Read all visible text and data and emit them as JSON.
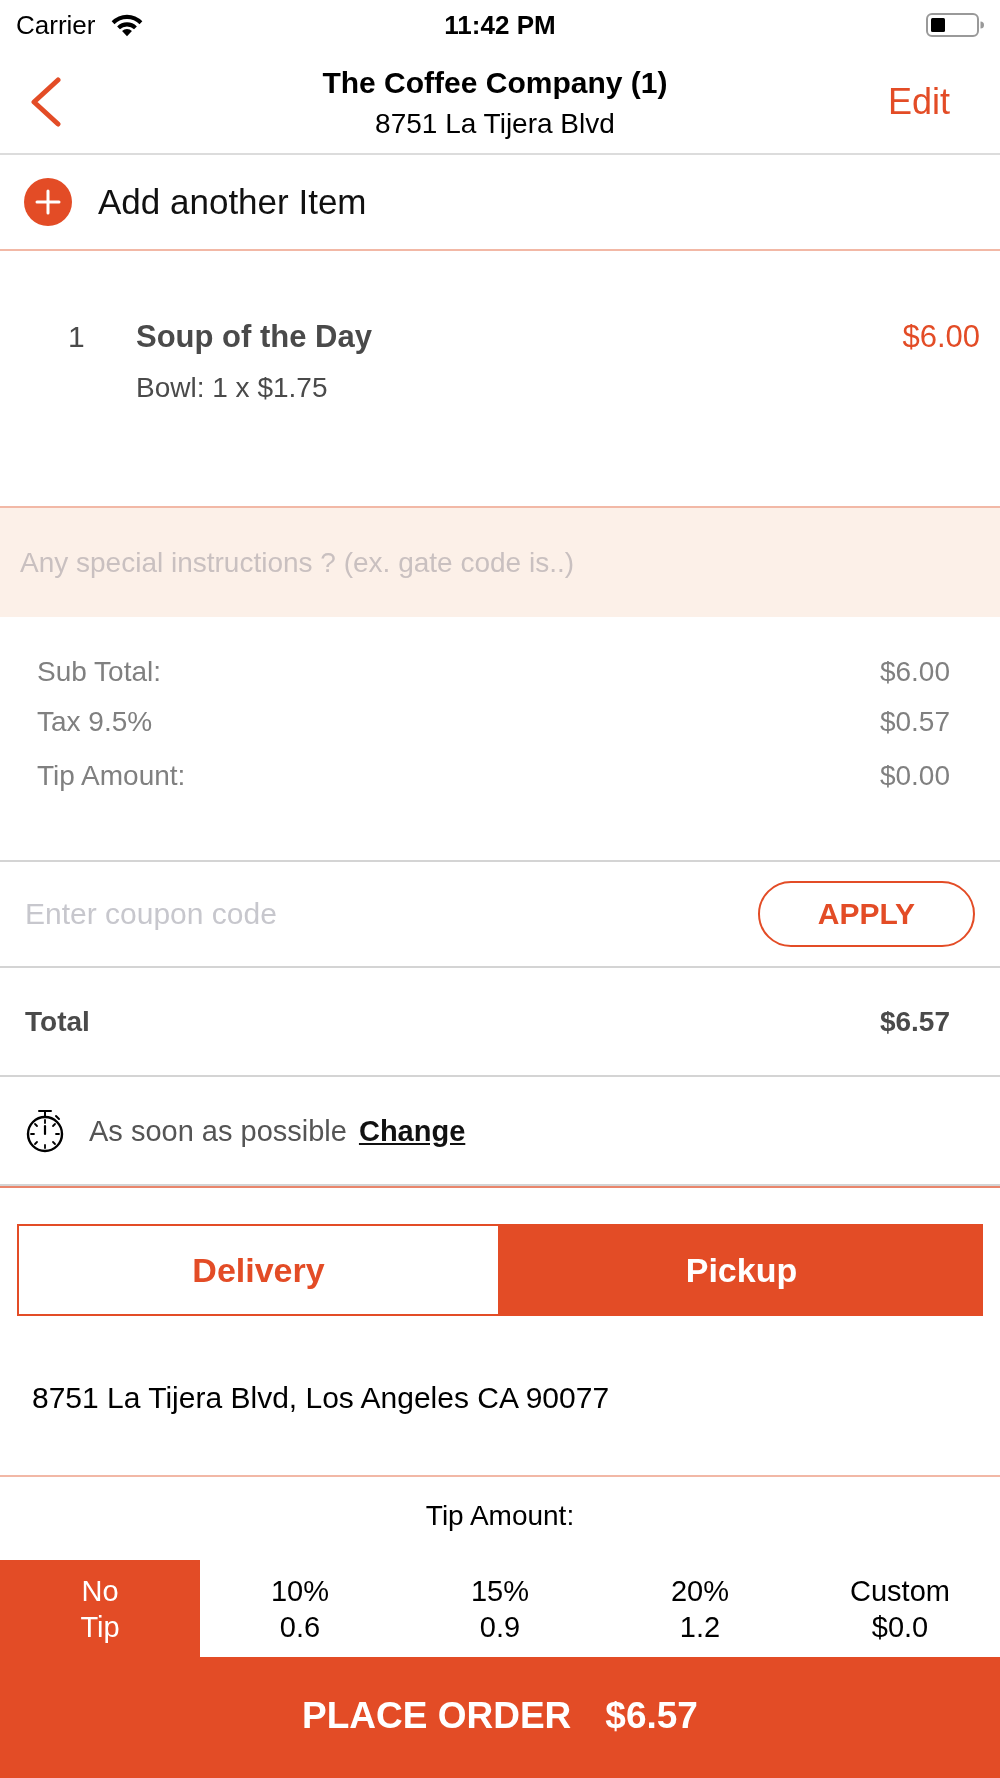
{
  "status_bar": {
    "carrier": "Carrier",
    "time": "11:42 PM"
  },
  "nav_bar": {
    "title": "The Coffee Company (1)",
    "subtitle": "8751 La Tijera Blvd",
    "action": "Edit"
  },
  "add_item": {
    "label": "Add another Item"
  },
  "items": [
    {
      "quantity": "1",
      "name": "Soup of the Day",
      "detail": "Bowl: 1 x $1.75",
      "price": "$6.00"
    }
  ],
  "instructions": {
    "placeholder": "Any special instructions ? (ex. gate code is..)"
  },
  "summary": [
    {
      "label": "Sub Total:",
      "value": "$6.00"
    },
    {
      "label": "Tax 9.5%",
      "value": "$0.57"
    },
    {
      "label": "Tip Amount:",
      "value": "$0.00"
    }
  ],
  "coupon": {
    "placeholder": "Enter coupon code",
    "button": "APPLY"
  },
  "total": {
    "label": "Total",
    "value": "$6.57"
  },
  "schedule": {
    "text": "As soon as possible",
    "link": "Change"
  },
  "order_type": [
    {
      "label": "Delivery",
      "selected": false
    },
    {
      "label": "Pickup",
      "selected": true
    }
  ],
  "address": "8751 La Tijera Blvd, Los Angeles CA 90077",
  "tip": {
    "title": "Tip Amount:",
    "options": [
      {
        "label": "No Tip",
        "selected": true
      },
      {
        "label": "10%",
        "amount": "0.6",
        "selected": false
      },
      {
        "label": "15%",
        "amount": "0.9",
        "selected": false
      },
      {
        "label": "20%",
        "amount": "1.2",
        "selected": false
      },
      {
        "label": "Custom",
        "amount": "$0.0",
        "selected": false
      }
    ]
  },
  "place_order": {
    "label": "PLACE ORDER",
    "amount": "$6.57"
  }
}
